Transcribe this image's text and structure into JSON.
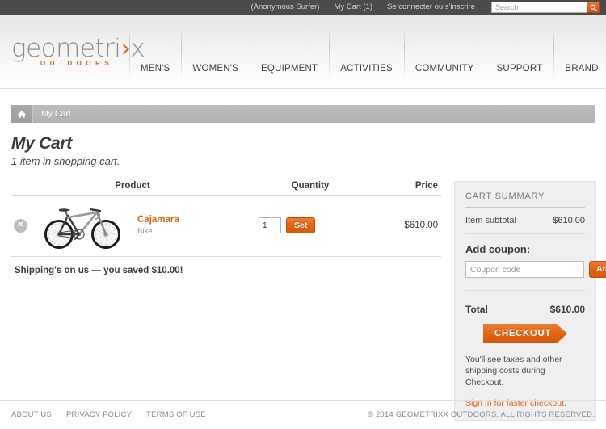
{
  "topbar": {
    "anonymous_label": "(Anonymous Surfer)",
    "cart_link": "My Cart (1)",
    "signin_link": "Se connecter ou s'inscrire",
    "search_placeholder": "Search",
    "search_value": "",
    "search_icon": "search-icon"
  },
  "brand": {
    "logo_text_a": "geometri",
    "logo_chevron": "›",
    "logo_text_b": "x",
    "logo_tagline": "OUTDOORS"
  },
  "nav": {
    "items": [
      {
        "label": "MEN'S"
      },
      {
        "label": "WOMEN'S"
      },
      {
        "label": "EQUIPMENT"
      },
      {
        "label": "ACTIVITIES"
      },
      {
        "label": "COMMUNITY"
      },
      {
        "label": "SUPPORT"
      },
      {
        "label": "BRAND"
      }
    ]
  },
  "breadcrumb": {
    "home_icon": "home-icon",
    "current": "My Cart"
  },
  "page": {
    "title": "My Cart",
    "subtitle": "1 item in shopping cart."
  },
  "cart": {
    "columns": {
      "product": "Product",
      "quantity": "Quantity",
      "price": "Price"
    },
    "items": [
      {
        "remove_icon": "close-icon",
        "thumbnail": "bicycle-image",
        "name": "Cajamara",
        "category": "Bike",
        "quantity": "1",
        "set_label": "Set",
        "price": "$610.00"
      }
    ],
    "shipping_note": "Shipping's on us — you saved $10.00!"
  },
  "summary": {
    "heading": "CART SUMMARY",
    "subtotal_label": "Item subtotal",
    "subtotal_value": "$610.00",
    "coupon_heading": "Add coupon:",
    "coupon_placeholder": "Coupon code",
    "coupon_value": "",
    "coupon_button": "Add",
    "total_label": "Total",
    "total_value": "$610.00",
    "checkout_button": "CHECKOUT",
    "tax_note": "You'll see taxes and other shipping costs during Checkout.",
    "signin_link": "Sign In for faster checkout."
  },
  "footer": {
    "links": [
      {
        "label": "ABOUT US"
      },
      {
        "label": "PRIVACY POLICY"
      },
      {
        "label": "TERMS OF USE"
      }
    ],
    "copyright": "© 2014 GEOMETRIXX OUTDOORS. ALL RIGHTS RESERVED."
  },
  "colors": {
    "accent": "#e2640f",
    "topbar_bg": "#4b4b4b",
    "panel_bg": "#efefef"
  }
}
